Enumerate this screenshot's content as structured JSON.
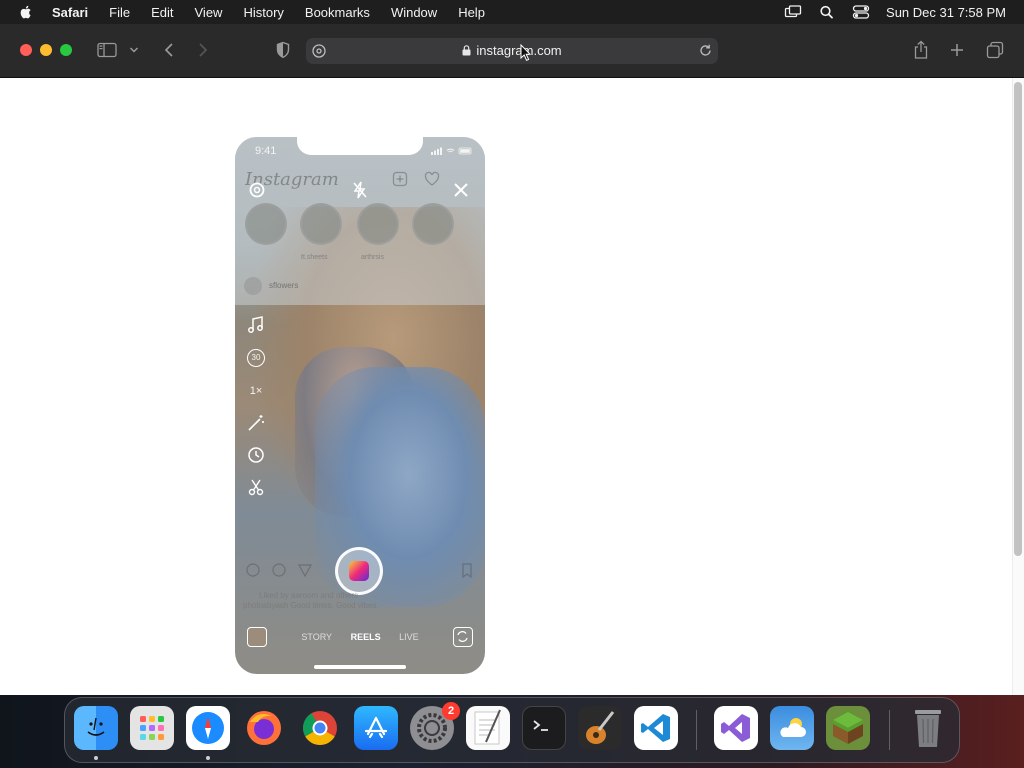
{
  "menubar": {
    "app_name": "Safari",
    "items": [
      "File",
      "Edit",
      "View",
      "History",
      "Bookmarks",
      "Window",
      "Help"
    ],
    "clock": "Sun Dec 31  7:58 PM"
  },
  "browser": {
    "url": "instagram.com"
  },
  "phone": {
    "time": "9:41",
    "ig_logo": "Instagram",
    "story_labels": [
      "",
      "tt.sheets",
      "arthrsis"
    ],
    "feed_user": "sflowers",
    "side_timer": "30",
    "side_speed": "1×",
    "caption_line1": "Liked by aaroom and others",
    "caption_line2": "photosbyash Good times. Good vibes.",
    "modes": [
      "STORY",
      "REELS",
      "LIVE"
    ],
    "active_mode": "REELS"
  },
  "dock": {
    "apps": [
      {
        "name": "Finder",
        "color": "#1e7cf2"
      },
      {
        "name": "Launchpad",
        "color": "#dcdcdc"
      },
      {
        "name": "Safari",
        "color": "#1a8cff"
      },
      {
        "name": "Firefox",
        "color": "#ff7139"
      },
      {
        "name": "Chrome",
        "color": "#ffffff"
      },
      {
        "name": "App Store",
        "color": "#1f8fff"
      },
      {
        "name": "System Settings",
        "color": "#8e8e93"
      },
      {
        "name": "TextEdit",
        "color": "#f5f5f5"
      },
      {
        "name": "Terminal",
        "color": "#111111"
      },
      {
        "name": "GarageBand",
        "color": "#2b2b2b"
      },
      {
        "name": "Visual Studio Code",
        "color": "#ffffff"
      },
      {
        "name": "Visual Studio",
        "color": "#ffffff"
      },
      {
        "name": "Weather",
        "color": "#3e8ce0"
      },
      {
        "name": "Minecraft",
        "color": "#6b8f3a"
      },
      {
        "name": "Trash",
        "color": "#6f7072"
      }
    ],
    "settings_badge": "2"
  }
}
